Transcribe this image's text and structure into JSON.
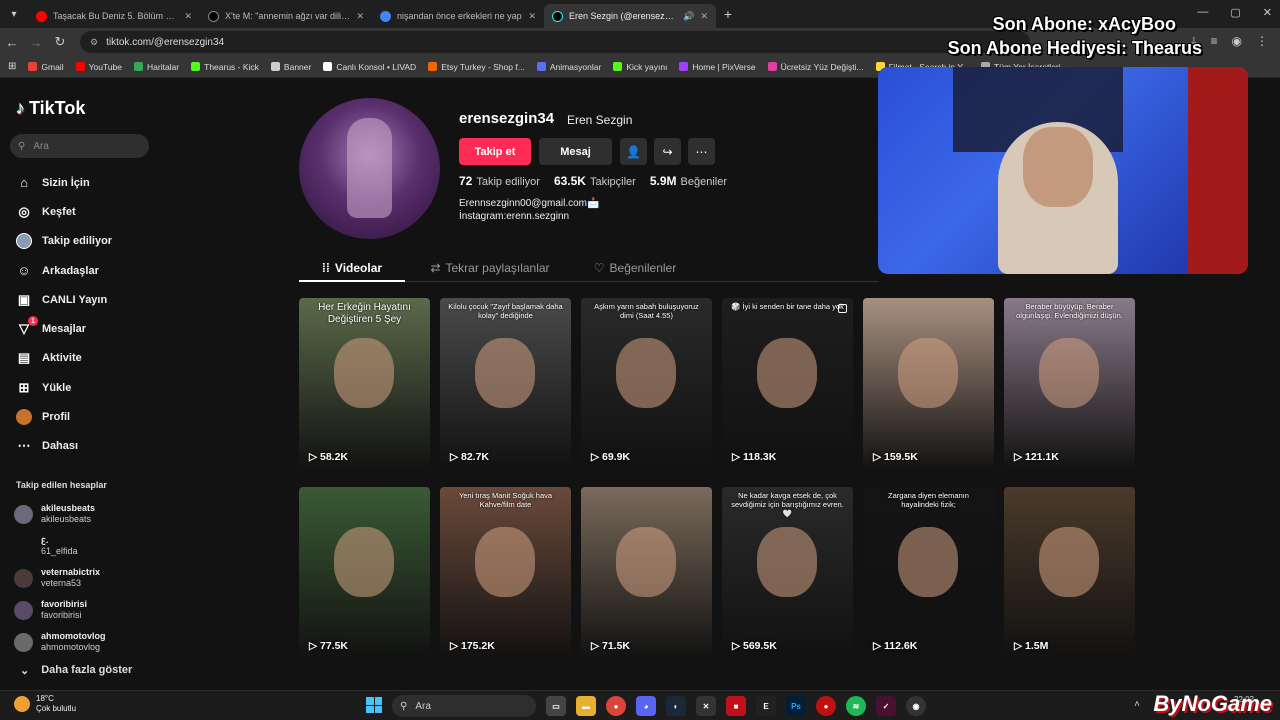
{
  "browser": {
    "tabs": [
      {
        "title": "Taşacak Bu Deniz 5. Bölüm @trt",
        "color": "#ff0000"
      },
      {
        "title": "X'te M: \"annemin ağzı var dili yok\"",
        "color": "#000000"
      },
      {
        "title": "nişandan önce erkekleri ne yap",
        "color": "#4285f4"
      },
      {
        "title": "Eren Sezgin (@erensezgin34)",
        "color": "#000000"
      }
    ],
    "new_tab": "+",
    "url": "tiktok.com/@erensezgin34",
    "bookmarks": [
      "Gmail",
      "YouTube",
      "Haritalar",
      "Thearus - Kick",
      "Banner",
      "Canlı Konsol • LIVAD",
      "Etsy Turkey - Shop f...",
      "Animasyonlar",
      "Kick yayını",
      "Home | PixVerse",
      "Ücretsiz Yüz Değişti...",
      "Filmot - Search in Y...",
      "Tüm Yer İşaretleri"
    ]
  },
  "sidebar": {
    "logo": "TikTok",
    "search_placeholder": "Ara",
    "nav": [
      {
        "label": "Sizin İçin",
        "icon": "home-icon",
        "glyph": "⌂"
      },
      {
        "label": "Keşfet",
        "icon": "compass-icon",
        "glyph": "◎"
      },
      {
        "label": "Takip ediliyor",
        "icon": "following-avatar-icon",
        "glyph": ""
      },
      {
        "label": "Arkadaşlar",
        "icon": "friends-icon",
        "glyph": "☺"
      },
      {
        "label": "CANLI Yayın",
        "icon": "live-icon",
        "glyph": "▣"
      },
      {
        "label": "Mesajlar",
        "icon": "messages-icon",
        "glyph": "▽",
        "badge": "1"
      },
      {
        "label": "Aktivite",
        "icon": "activity-icon",
        "glyph": "▤"
      },
      {
        "label": "Yükle",
        "icon": "upload-icon",
        "glyph": "⊞"
      },
      {
        "label": "Profil",
        "icon": "profile-avatar-icon",
        "glyph": ""
      },
      {
        "label": "Dahası",
        "icon": "more-dots-icon",
        "glyph": "⋯"
      }
    ],
    "following_title": "Takip edilen hesaplar",
    "following": [
      {
        "name": "akileusbeats",
        "handle": "akileusbeats"
      },
      {
        "name": "ꜫ.",
        "handle": "61_elfida"
      },
      {
        "name": "veternabictrix",
        "handle": "veterna53"
      },
      {
        "name": "favoribirisi",
        "handle": "favoribirisi"
      },
      {
        "name": "ahmomotovlog",
        "handle": "ahmomotovlog"
      }
    ],
    "more_accounts": "Daha fazla göster"
  },
  "profile": {
    "username": "erensezgin34",
    "display_name": "Eren Sezgin",
    "follow_label": "Takip et",
    "message_label": "Mesaj",
    "following_count": "72",
    "following_label": "Takip ediliyor",
    "followers_count": "63.5K",
    "followers_label": "Takipçiler",
    "likes_count": "5.9M",
    "likes_label": "Beğeniler",
    "bio_email": "Erennsezginn00@gmail.com📩",
    "bio_instagram": "İnstagram:erenn.sezginn",
    "tabs": [
      "Videolar",
      "Tekrar paylaşılanlar",
      "Beğenilenler"
    ]
  },
  "videos": [
    {
      "views": "58.2K",
      "caption": "Her Erkeğin Hayatını Değiştiren 5 Şey",
      "big": true,
      "bg": "#5a6a4a"
    },
    {
      "views": "82.7K",
      "caption": "Kilolu çocuk \"Zayıf başlamak daha kolay\" dediğinde",
      "big": false,
      "bg": "#4a4a4a"
    },
    {
      "views": "69.9K",
      "caption": "Aşkım yarın sabah buluşuyoruz dimi (Saat 4.55)",
      "big": false,
      "bg": "#2a2a2a"
    },
    {
      "views": "118.3K",
      "caption": "🎲 İyi ki senden bir tane daha yok",
      "big": false,
      "bg": "#1e1e1e",
      "multi": true
    },
    {
      "views": "159.5K",
      "caption": "",
      "big": false,
      "bg": "#a89080"
    },
    {
      "views": "121.1K",
      "caption": "Beraber büyüyüp. Beraber olgunlaşıp. Evlendiğimizi düşün.",
      "big": false,
      "bg": "#8a7a88"
    },
    {
      "views": "77.5K",
      "caption": "",
      "big": false,
      "bg": "#3a5a34"
    },
    {
      "views": "175.2K",
      "caption": "Yeni tıraş Manit Soğuk hava Kahve/film date",
      "big": false,
      "bg": "#6a4a3a"
    },
    {
      "views": "71.5K",
      "caption": "",
      "big": false,
      "bg": "#7a6a5a"
    },
    {
      "views": "569.5K",
      "caption": "Ne kadar kavga etsek de, çok sevdiğimiz için barıştığımız evren. 🤍",
      "big": false,
      "bg": "#2a2a2a"
    },
    {
      "views": "112.6K",
      "caption": "Zargana diyen elemanın hayalindeki fizik;",
      "big": false,
      "bg": "#141414"
    },
    {
      "views": "1.5M",
      "caption": "",
      "big": false,
      "bg": "#4a3a2a"
    }
  ],
  "overlay": {
    "line1": "Son Abone: xAcyBoo",
    "line2": "Son Abone Hediyesi: Thearus"
  },
  "taskbar": {
    "temp": "18°C",
    "weather": "Çok bulutlu",
    "search": "Ara",
    "brand": "ByNoGame",
    "time": "22:02"
  }
}
